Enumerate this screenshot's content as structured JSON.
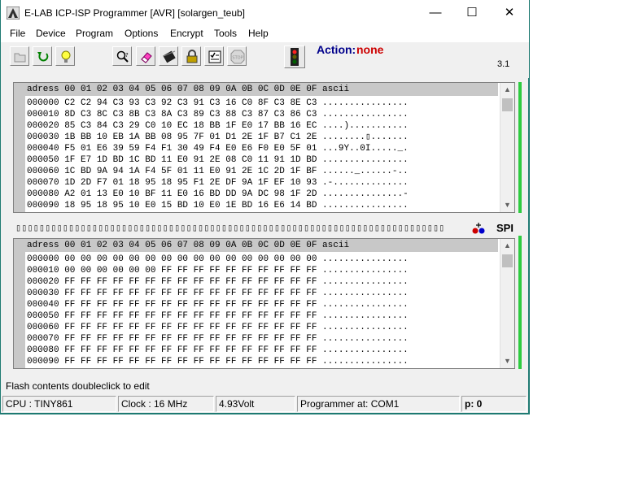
{
  "window": {
    "title": "E-LAB ICP-ISP Programmer [AVR]  [solargen_teub]",
    "controls": {
      "minimize": "—",
      "maximize": "☐",
      "close": "✕"
    }
  },
  "menu": [
    "File",
    "Device",
    "Program",
    "Options",
    "Encrypt",
    "Tools",
    "Help"
  ],
  "toolbar": {
    "action_label": "Action:",
    "action_value": "none",
    "version": "3.1",
    "stop_label": "STOP",
    "buttons": [
      "open-icon",
      "reload-icon",
      "lightbulb-icon",
      "search-icon",
      "eraser-icon",
      "chip-icon",
      "lock-icon",
      "checklist-icon",
      "stop-icon",
      "traffic-light-icon"
    ]
  },
  "flash": {
    "header": "adress 00 01 02 03 04 05 06 07 08 09 0A 0B 0C 0D 0E 0F ascii",
    "rows": [
      "000000 C2 C2 94 C3 93 C3 92 C3 91 C3 16 C0 8F C3 8E C3 ................",
      "000010 8D C3 8C C3 8B C3 8A C3 89 C3 88 C3 87 C3 86 C3 ................",
      "000020 85 C3 84 C3 29 C0 10 EC 18 BB 1F E0 17 BB 16 EC ....)...........",
      "000030 1B BB 10 EB 1A BB 08 95 7F 01 D1 2E 1F B7 C1 2E ........▯.......",
      "000040 F5 01 E6 39 59 F4 F1 30 49 F4 E0 E6 F0 E0 5F 01 ...9Y..0I....._.",
      "000050 1F E7 1D BD 1C BD 11 E0 91 2E 08 C0 11 91 1D BD ................",
      "000060 1C BD 9A 94 1A F4 5F 01 11 E0 91 2E 1C 2D 1F BF ......_......-..",
      "000070 1D 2D F7 01 18 95 18 95 F1 2E DF 9A 1F EF 10 93 .-..............",
      "000080 A2 01 13 E0 10 BF 11 E0 16 BD DD 9A DC 98 1F 2D ...............-",
      "000090 18 95 18 95 10 E0 15 BD 10 E0 1E BD 16 E6 14 BD ................"
    ]
  },
  "cellstrip": "▯▯▯▯▯▯▯▯▯▯▯▯▯▯▯▯▯▯▯▯▯▯▯▯▯▯▯▯▯▯▯▯▯▯▯▯▯▯▯▯▯▯▯▯▯▯▯▯▯▯▯▯▯▯▯▯▯▯▯▯▯▯▯▯▯▯▯▯▯▯▯▯▯",
  "interface_label": "SPI",
  "eeprom": {
    "header": "adress 00 01 02 03 04 05 06 07 08 09 0A 0B 0C 0D 0E 0F ascii",
    "rows": [
      "000000 00 00 00 00 00 00 00 00 00 00 00 00 00 00 00 00 ................",
      "000010 00 00 00 00 00 00 FF FF FF FF FF FF FF FF FF FF ................",
      "000020 FF FF FF FF FF FF FF FF FF FF FF FF FF FF FF FF ................",
      "000030 FF FF FF FF FF FF FF FF FF FF FF FF FF FF FF FF ................",
      "000040 FF FF FF FF FF FF FF FF FF FF FF FF FF FF FF FF ................",
      "000050 FF FF FF FF FF FF FF FF FF FF FF FF FF FF FF FF ................",
      "000060 FF FF FF FF FF FF FF FF FF FF FF FF FF FF FF FF ................",
      "000070 FF FF FF FF FF FF FF FF FF FF FF FF FF FF FF FF ................",
      "000080 FF FF FF FF FF FF FF FF FF FF FF FF FF FF FF FF ................",
      "000090 FF FF FF FF FF FF FF FF FF FF FF FF FF FF FF FF ................"
    ]
  },
  "hint": "Flash contents doubleclick to edit",
  "status": {
    "cpu": "CPU : TINY861",
    "clock": "Clock : 16 MHz",
    "voltage": "4.93Volt",
    "programmer": "Programmer at: COM1",
    "page": "p: 0"
  },
  "colors": {
    "accent": "#2ecc40",
    "action_label": "#00008b",
    "action_value": "#cc0000",
    "border": "#1e7a72"
  }
}
